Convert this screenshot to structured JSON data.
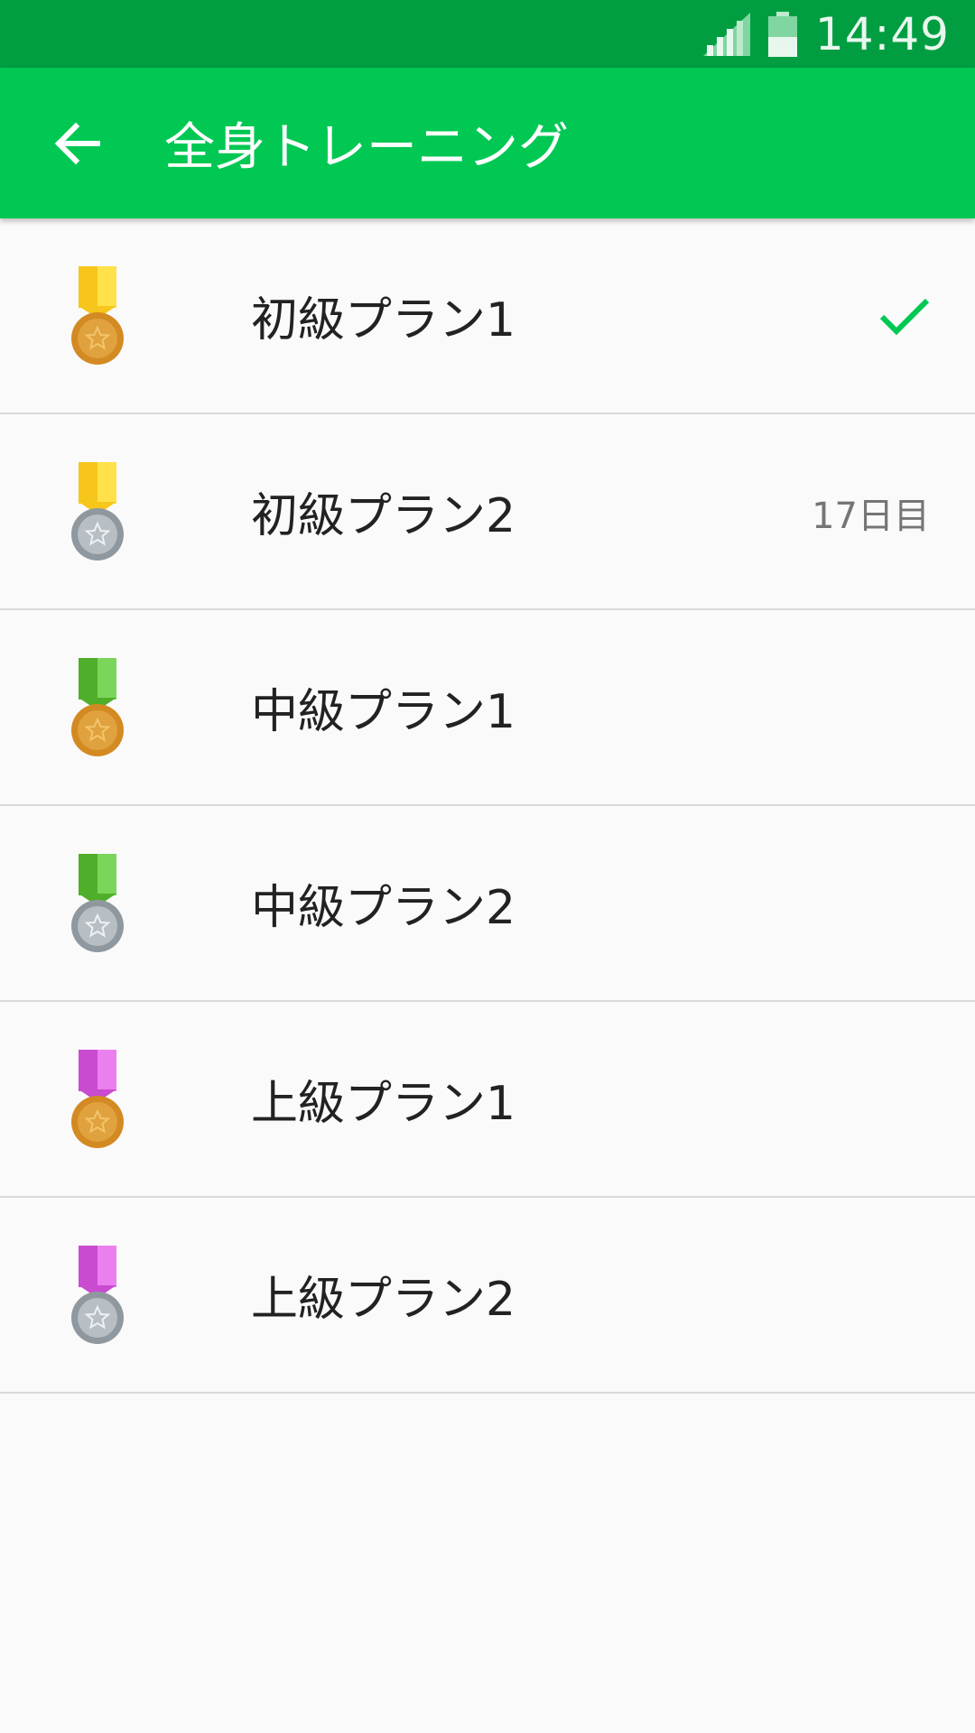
{
  "status_bar": {
    "time": "14:49",
    "icons": [
      "signal-icon",
      "battery-icon"
    ]
  },
  "app_bar": {
    "back_icon": "arrow-left-icon",
    "title": "全身トレーニング"
  },
  "colors": {
    "status_bar": "#009e41",
    "app_bar": "#00c853",
    "accent_check": "#00c853",
    "medal_gold": "#d9902a",
    "medal_silver": "#9aa3ab",
    "ribbon_yellow": "#f6c61a",
    "ribbon_green": "#5fbf38",
    "ribbon_magenta": "#d35ad6"
  },
  "plans": [
    {
      "label": "初級プラン1",
      "ribbon": "yellow",
      "medal": "gold",
      "status": "checked",
      "status_text": ""
    },
    {
      "label": "初級プラン2",
      "ribbon": "yellow",
      "medal": "silver",
      "status": "day",
      "status_text": "17日目"
    },
    {
      "label": "中級プラン1",
      "ribbon": "green",
      "medal": "gold",
      "status": "none",
      "status_text": ""
    },
    {
      "label": "中級プラン2",
      "ribbon": "green",
      "medal": "silver",
      "status": "none",
      "status_text": ""
    },
    {
      "label": "上級プラン1",
      "ribbon": "magenta",
      "medal": "gold",
      "status": "none",
      "status_text": ""
    },
    {
      "label": "上級プラン2",
      "ribbon": "magenta",
      "medal": "silver",
      "status": "none",
      "status_text": ""
    }
  ]
}
